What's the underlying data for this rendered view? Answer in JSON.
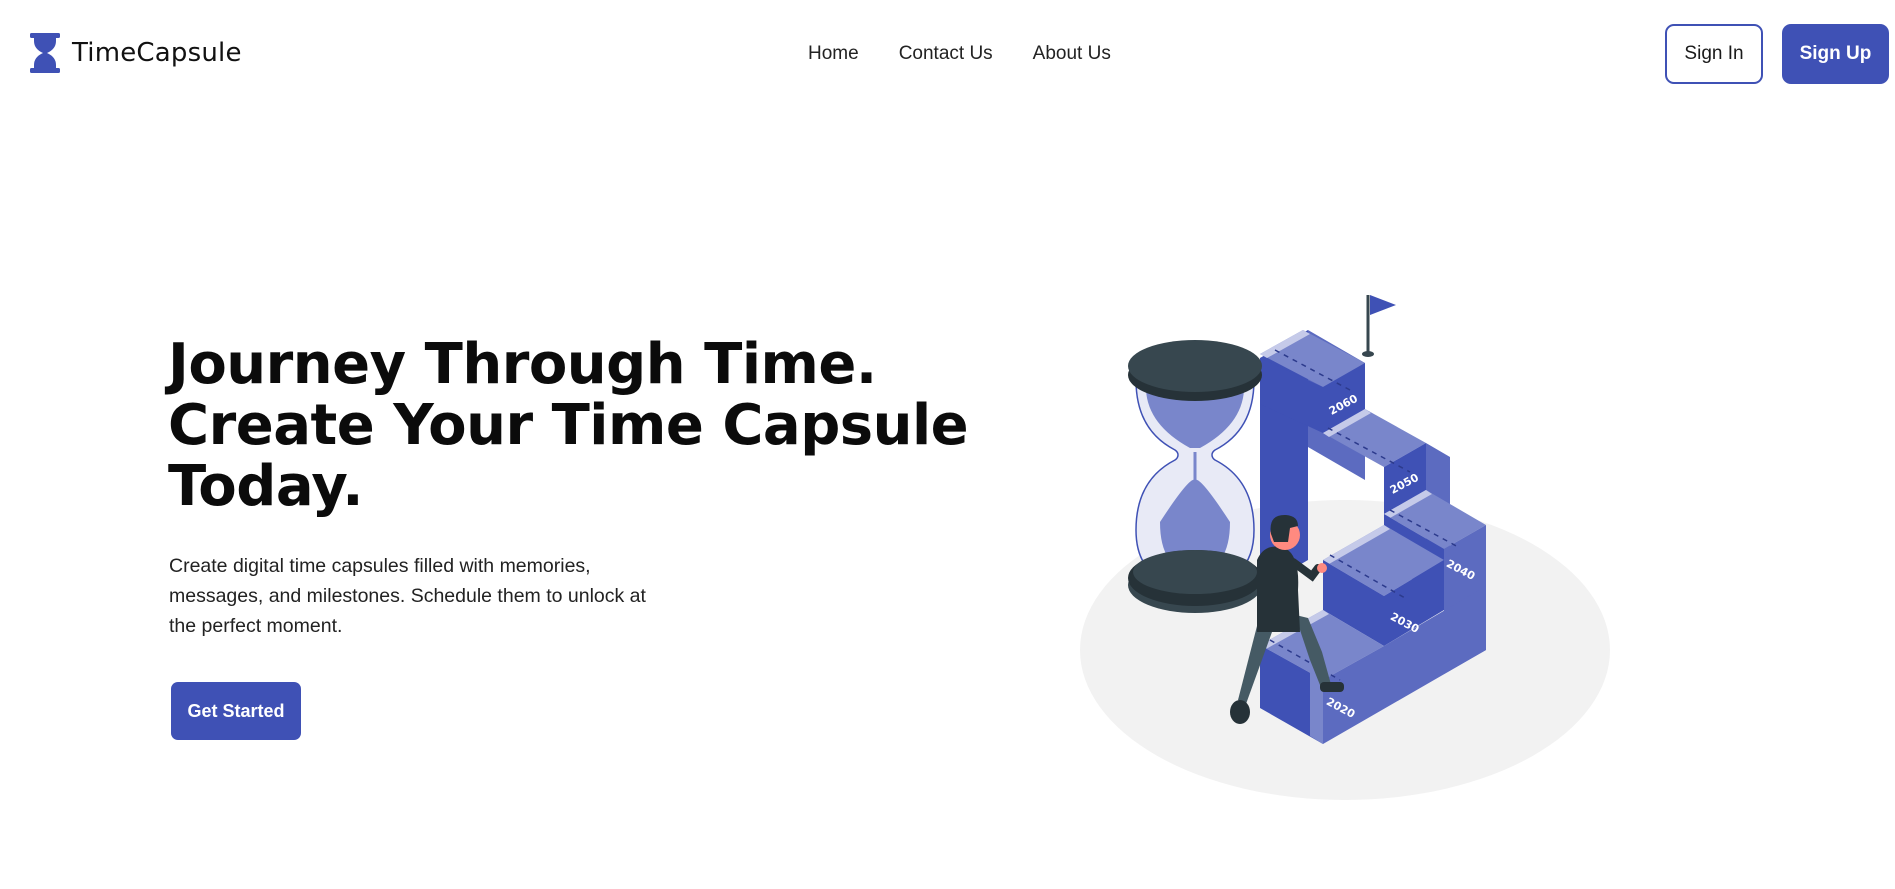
{
  "brand": {
    "name": "TimeCapsule",
    "icon": "hourglass-icon"
  },
  "nav": {
    "links": [
      "Home",
      "Contact Us",
      "About Us"
    ]
  },
  "auth": {
    "sign_in": "Sign In",
    "sign_up": "Sign Up"
  },
  "hero": {
    "title_lines": [
      "Journey Through Time.",
      "Create Your Time Capsule",
      "Today."
    ],
    "description_lines": [
      "Create digital time capsules filled with memories,",
      "messages, and milestones. Schedule them to unlock at",
      "the perfect moment."
    ],
    "cta": "Get Started"
  },
  "illustration": {
    "years": [
      "2020",
      "2030",
      "2040",
      "2050",
      "2060"
    ]
  },
  "colors": {
    "accent": "#3f51b5",
    "accent_light": "#7986cb",
    "accent_pale": "#c5cae9",
    "dark": "#37474f",
    "text": "#111111",
    "background": "#ffffff"
  }
}
